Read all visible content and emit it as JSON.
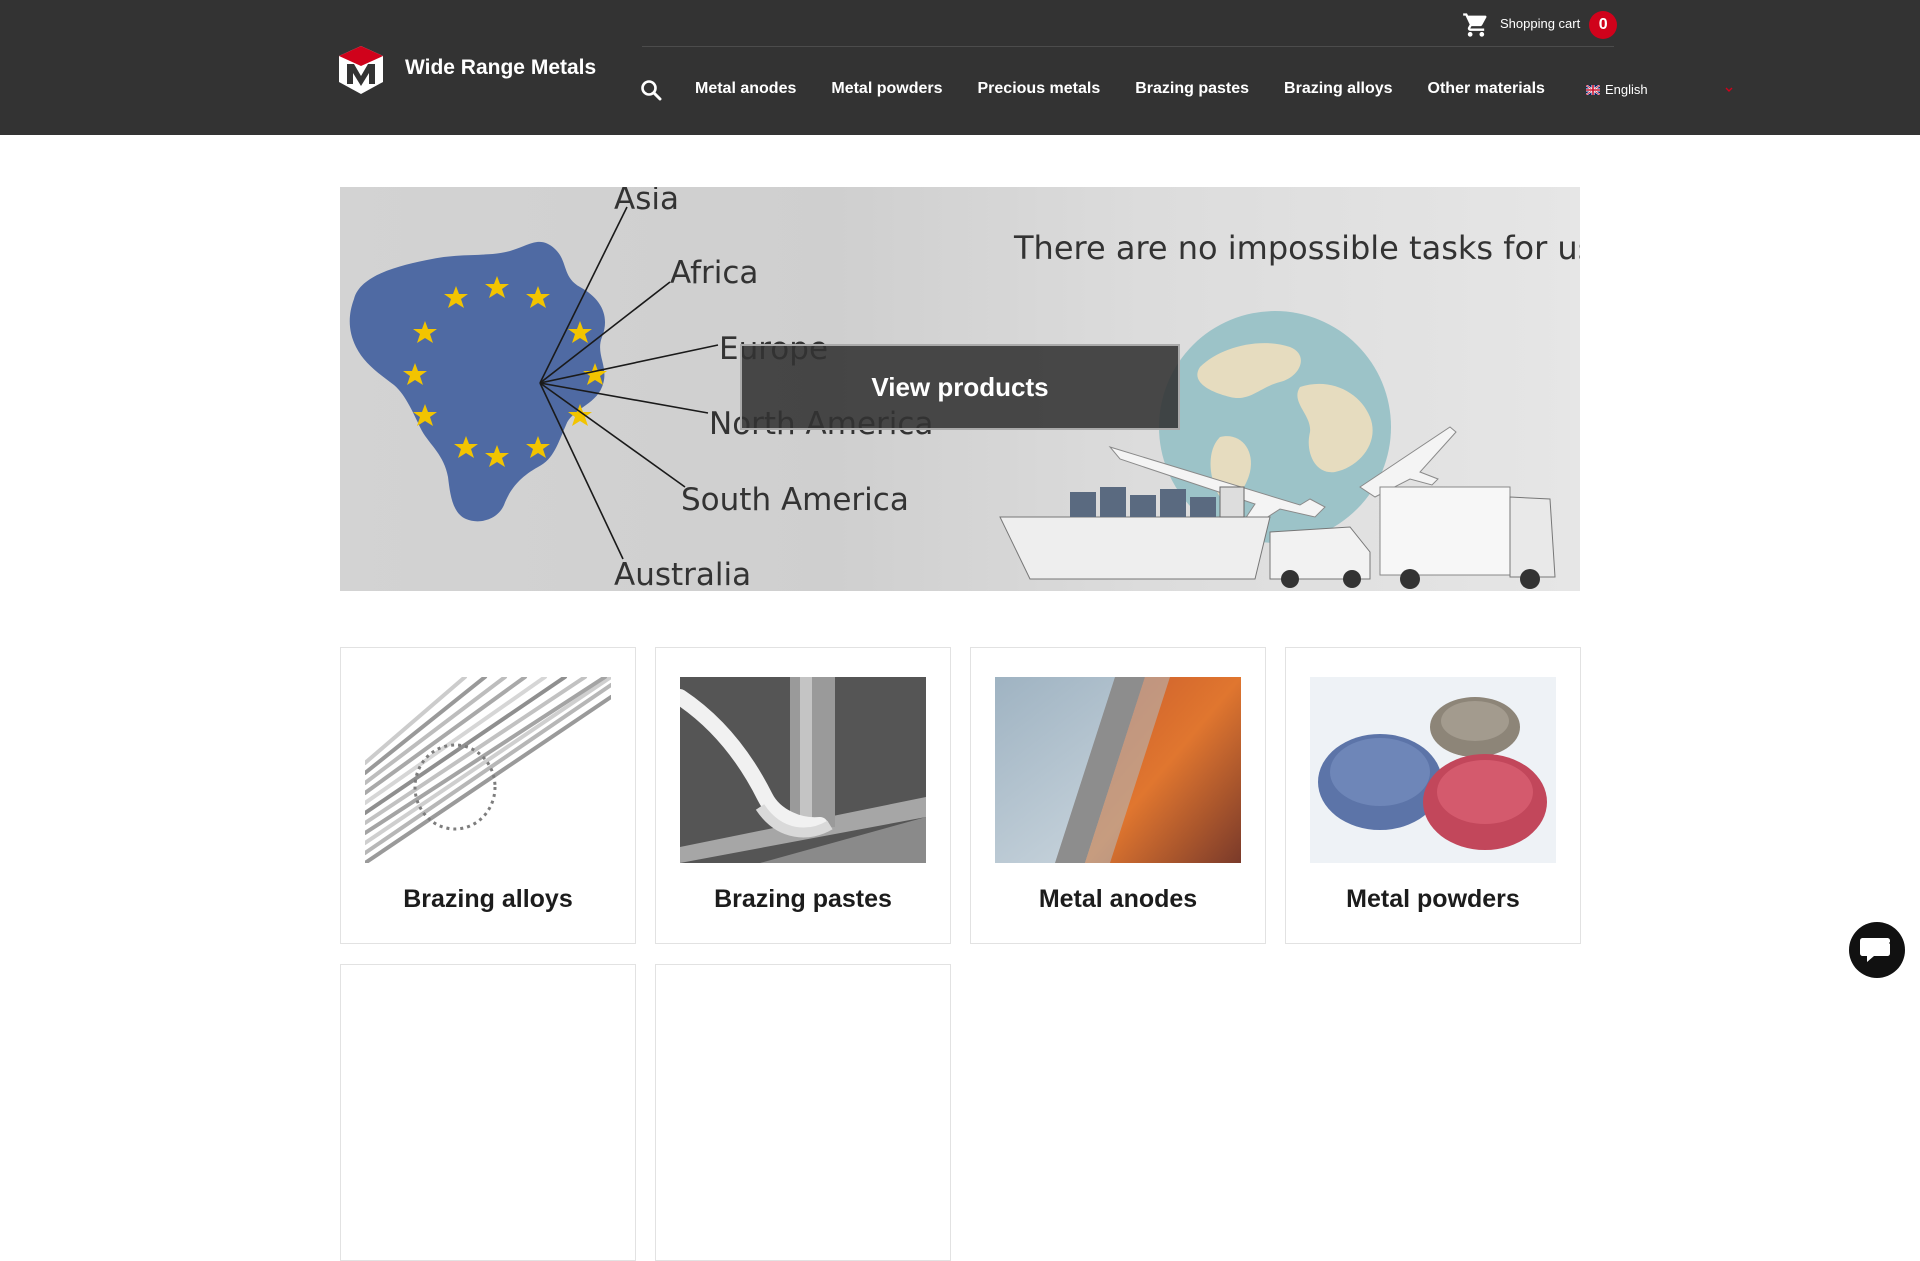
{
  "header": {
    "brand": "Wide Range Metals",
    "cart_label": "Shopping cart",
    "cart_count": "0",
    "language": "English",
    "nav": [
      "Metal anodes",
      "Metal powders",
      "Precious metals",
      "Brazing pastes",
      "Brazing alloys",
      "Other materials"
    ]
  },
  "hero": {
    "regions": [
      "Asia",
      "Africa",
      "Europe",
      "North America",
      "South America",
      "Australia"
    ],
    "slogan": "There are no impossible tasks for us",
    "button": "View products"
  },
  "categories": [
    "Brazing alloys",
    "Brazing pastes",
    "Metal anodes",
    "Metal powders"
  ],
  "colors": {
    "header": "#333333",
    "badge": "#d0021b",
    "map": "#4f6aa3",
    "stars": "#f2c400"
  },
  "icons": [
    "logo-icon",
    "cart-icon",
    "search-icon",
    "flag-uk-icon",
    "chevron-down-icon",
    "chat-icon"
  ]
}
